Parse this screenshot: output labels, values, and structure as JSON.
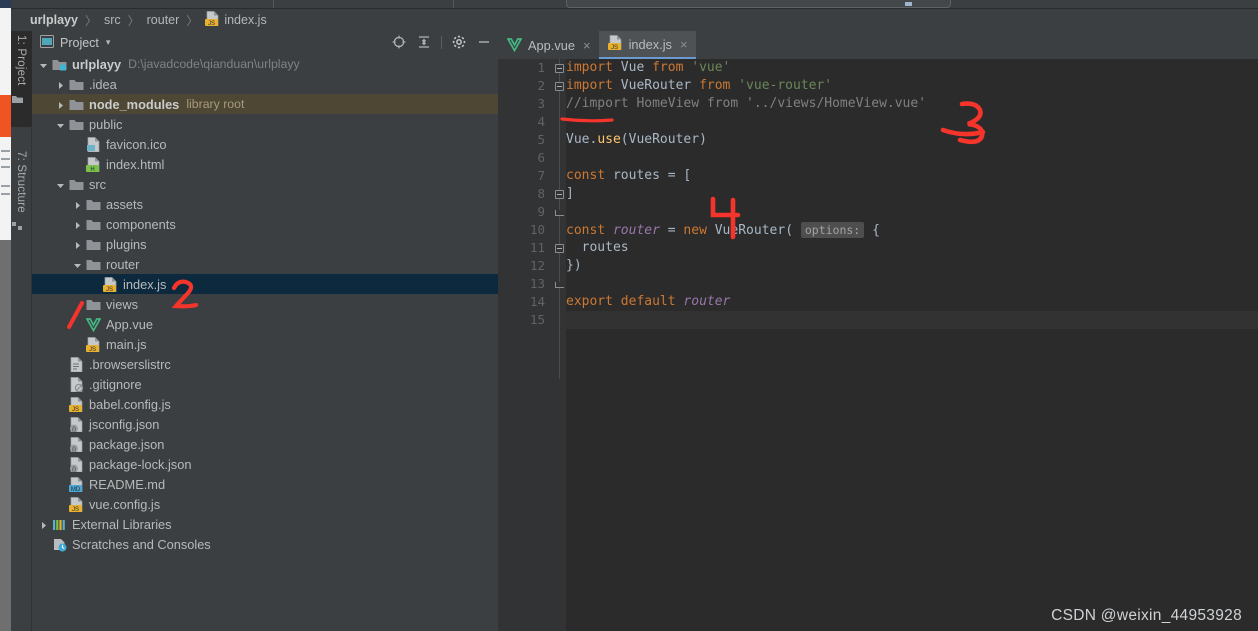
{
  "app": {
    "breadcrumb": [
      {
        "label": "urlplayy",
        "bold": true,
        "icon": "none"
      },
      {
        "label": "src",
        "bold": false,
        "icon": "none"
      },
      {
        "label": "router",
        "bold": false,
        "icon": "none"
      },
      {
        "label": "index.js",
        "bold": false,
        "icon": "js-file-icon"
      }
    ],
    "breadcrumb_separator": "〉",
    "watermark": "CSDN @weixin_44953928"
  },
  "toolstrip": {
    "tabs": [
      {
        "label": "1: Project",
        "icon": "project-icon",
        "active": true
      },
      {
        "label": "7: Structure",
        "icon": "structure-icon",
        "active": false
      }
    ]
  },
  "project_panel": {
    "title": "Project",
    "caret": "▾",
    "actions": [
      {
        "name": "select-opened-file-icon",
        "label": "Select Opened File"
      },
      {
        "name": "collapse-all-icon",
        "label": "Collapse All"
      },
      {
        "name": "settings-gear-icon",
        "label": "Settings"
      },
      {
        "name": "hide-panel-icon",
        "label": "Hide"
      }
    ],
    "tree": [
      {
        "label": "urlplayy",
        "sub": "D:\\javadcode\\qianduan\\urlplayy",
        "indent": 0,
        "arrow": "down",
        "icon": "module-folder-icon",
        "bold": true,
        "selected": false,
        "highlight": false
      },
      {
        "label": ".idea",
        "sub": "",
        "indent": 1,
        "arrow": "right",
        "icon": "folder-icon",
        "bold": false,
        "selected": false,
        "highlight": false
      },
      {
        "label": "node_modules",
        "sub": "library root",
        "indent": 1,
        "arrow": "right",
        "icon": "folder-icon",
        "bold": true,
        "selected": false,
        "highlight": true
      },
      {
        "label": "public",
        "sub": "",
        "indent": 1,
        "arrow": "down",
        "icon": "folder-icon",
        "bold": false,
        "selected": false,
        "highlight": false
      },
      {
        "label": "favicon.ico",
        "sub": "",
        "indent": 2,
        "arrow": "none",
        "icon": "image-file-icon",
        "bold": false,
        "selected": false,
        "highlight": false
      },
      {
        "label": "index.html",
        "sub": "",
        "indent": 2,
        "arrow": "none",
        "icon": "html-file-icon",
        "bold": false,
        "selected": false,
        "highlight": false
      },
      {
        "label": "src",
        "sub": "",
        "indent": 1,
        "arrow": "down",
        "icon": "source-folder-icon",
        "bold": false,
        "selected": false,
        "highlight": false
      },
      {
        "label": "assets",
        "sub": "",
        "indent": 2,
        "arrow": "right",
        "icon": "folder-icon",
        "bold": false,
        "selected": false,
        "highlight": false
      },
      {
        "label": "components",
        "sub": "",
        "indent": 2,
        "arrow": "right",
        "icon": "folder-icon",
        "bold": false,
        "selected": false,
        "highlight": false
      },
      {
        "label": "plugins",
        "sub": "",
        "indent": 2,
        "arrow": "right",
        "icon": "folder-icon",
        "bold": false,
        "selected": false,
        "highlight": false
      },
      {
        "label": "router",
        "sub": "",
        "indent": 2,
        "arrow": "down",
        "icon": "folder-icon",
        "bold": false,
        "selected": false,
        "highlight": false
      },
      {
        "label": "index.js",
        "sub": "",
        "indent": 3,
        "arrow": "none",
        "icon": "js-file-icon",
        "bold": false,
        "selected": true,
        "highlight": false
      },
      {
        "label": "views",
        "sub": "",
        "indent": 2,
        "arrow": "none",
        "icon": "folder-icon",
        "bold": false,
        "selected": false,
        "highlight": false
      },
      {
        "label": "App.vue",
        "sub": "",
        "indent": 2,
        "arrow": "none",
        "icon": "vue-file-icon",
        "bold": false,
        "selected": false,
        "highlight": false
      },
      {
        "label": "main.js",
        "sub": "",
        "indent": 2,
        "arrow": "none",
        "icon": "js-file-icon",
        "bold": false,
        "selected": false,
        "highlight": false
      },
      {
        "label": ".browserslistrc",
        "sub": "",
        "indent": 1,
        "arrow": "none",
        "icon": "text-file-icon",
        "bold": false,
        "selected": false,
        "highlight": false
      },
      {
        "label": ".gitignore",
        "sub": "",
        "indent": 1,
        "arrow": "none",
        "icon": "gitignore-file-icon",
        "bold": false,
        "selected": false,
        "highlight": false
      },
      {
        "label": "babel.config.js",
        "sub": "",
        "indent": 1,
        "arrow": "none",
        "icon": "js-file-icon",
        "bold": false,
        "selected": false,
        "highlight": false
      },
      {
        "label": "jsconfig.json",
        "sub": "",
        "indent": 1,
        "arrow": "none",
        "icon": "json-file-icon",
        "bold": false,
        "selected": false,
        "highlight": false
      },
      {
        "label": "package.json",
        "sub": "",
        "indent": 1,
        "arrow": "none",
        "icon": "json-file-icon",
        "bold": false,
        "selected": false,
        "highlight": false
      },
      {
        "label": "package-lock.json",
        "sub": "",
        "indent": 1,
        "arrow": "none",
        "icon": "json-file-icon",
        "bold": false,
        "selected": false,
        "highlight": false
      },
      {
        "label": "README.md",
        "sub": "",
        "indent": 1,
        "arrow": "none",
        "icon": "markdown-file-icon",
        "bold": false,
        "selected": false,
        "highlight": false
      },
      {
        "label": "vue.config.js",
        "sub": "",
        "indent": 1,
        "arrow": "none",
        "icon": "js-file-icon",
        "bold": false,
        "selected": false,
        "highlight": false
      },
      {
        "label": "External Libraries",
        "sub": "",
        "indent": 0,
        "arrow": "right",
        "icon": "libraries-icon",
        "bold": false,
        "selected": false,
        "highlight": false
      },
      {
        "label": "Scratches and Consoles",
        "sub": "",
        "indent": 0,
        "arrow": "none",
        "icon": "scratches-icon",
        "bold": false,
        "selected": false,
        "highlight": false
      }
    ]
  },
  "editor": {
    "tabs": [
      {
        "label": "App.vue",
        "icon": "vue-file-icon",
        "active": false,
        "close": "×"
      },
      {
        "label": "index.js",
        "icon": "js-file-icon",
        "active": true,
        "close": "×"
      }
    ],
    "line_numbers": [
      "1",
      "2",
      "3",
      "4",
      "5",
      "6",
      "7",
      "8",
      "9",
      "10",
      "11",
      "12",
      "13",
      "14",
      "15"
    ],
    "current_line": 15,
    "code": [
      {
        "n": 1,
        "text": "import Vue from 'vue'"
      },
      {
        "n": 2,
        "text": "import VueRouter from 'vue-router'"
      },
      {
        "n": 3,
        "text": "//import HomeView from '../views/HomeView.vue'"
      },
      {
        "n": 4,
        "text": ""
      },
      {
        "n": 5,
        "text": "Vue.use(VueRouter)"
      },
      {
        "n": 6,
        "text": ""
      },
      {
        "n": 7,
        "text": "const routes = ["
      },
      {
        "n": 8,
        "text": "]"
      },
      {
        "n": 9,
        "text": ""
      },
      {
        "n": 10,
        "text": "const router = new VueRouter( options: {"
      },
      {
        "n": 11,
        "text": "  routes"
      },
      {
        "n": 12,
        "text": "})"
      },
      {
        "n": 13,
        "text": ""
      },
      {
        "n": 14,
        "text": "export default router"
      },
      {
        "n": 15,
        "text": ""
      }
    ],
    "inlay_hint": "options:"
  },
  "annotations": {
    "color": "#f5342b",
    "marks": [
      {
        "name": "annotation-2",
        "text": "2"
      },
      {
        "name": "annotation-3",
        "text": "3"
      },
      {
        "name": "annotation-4",
        "text": "4"
      },
      {
        "name": "annotation-slash",
        "text": "/"
      },
      {
        "name": "annotation-underline",
        "text": ""
      }
    ]
  }
}
